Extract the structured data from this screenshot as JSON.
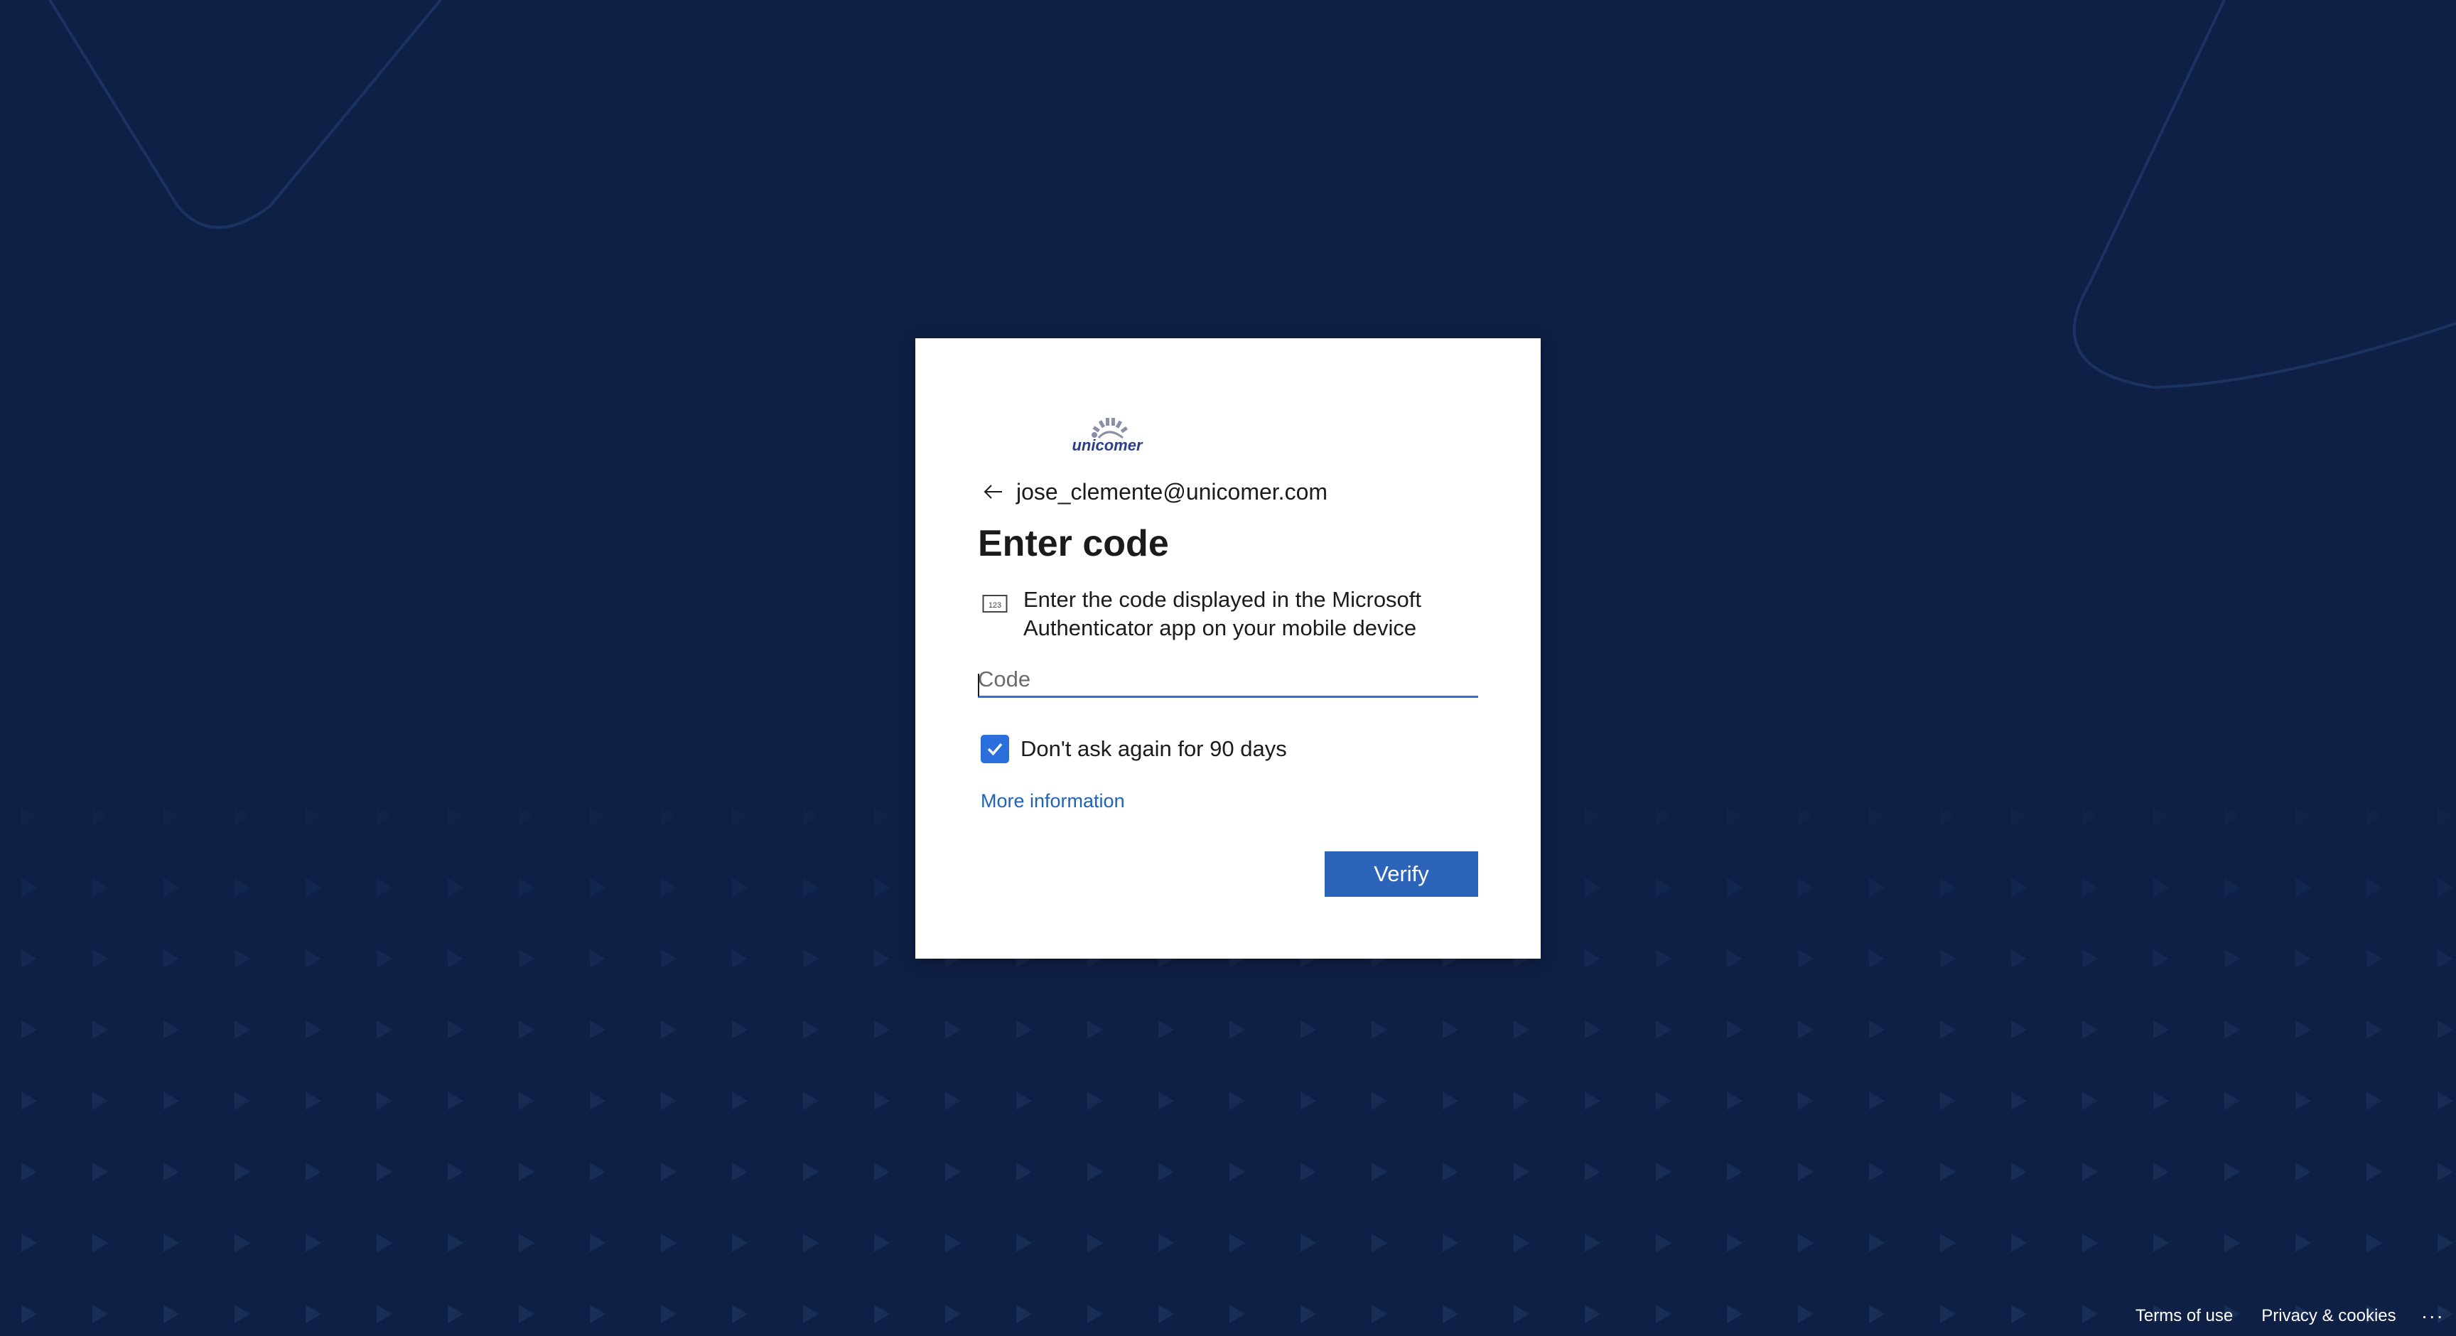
{
  "identity": {
    "email": "jose_clemente@unicomer.com"
  },
  "logo": {
    "text": "unicomer"
  },
  "main": {
    "title": "Enter code",
    "instruction": "Enter the code displayed in the Microsoft Authenticator app on your mobile device",
    "code_placeholder": "Code",
    "code_value": "",
    "remember_label": "Don't ask again for 90 days",
    "remember_checked": true,
    "more_info_label": "More information",
    "verify_label": "Verify"
  },
  "footer": {
    "terms_label": "Terms of use",
    "privacy_label": "Privacy & cookies",
    "more_label": "..."
  },
  "colors": {
    "background": "#0e2045",
    "accent": "#2b64b8",
    "link": "#1f62b8",
    "input_underline": "#2f6fd1",
    "checkbox": "#2a6fdb"
  },
  "icons": {
    "back": "arrow-left-icon",
    "code": "numeric-keypad-icon",
    "check": "checkmark-icon"
  }
}
